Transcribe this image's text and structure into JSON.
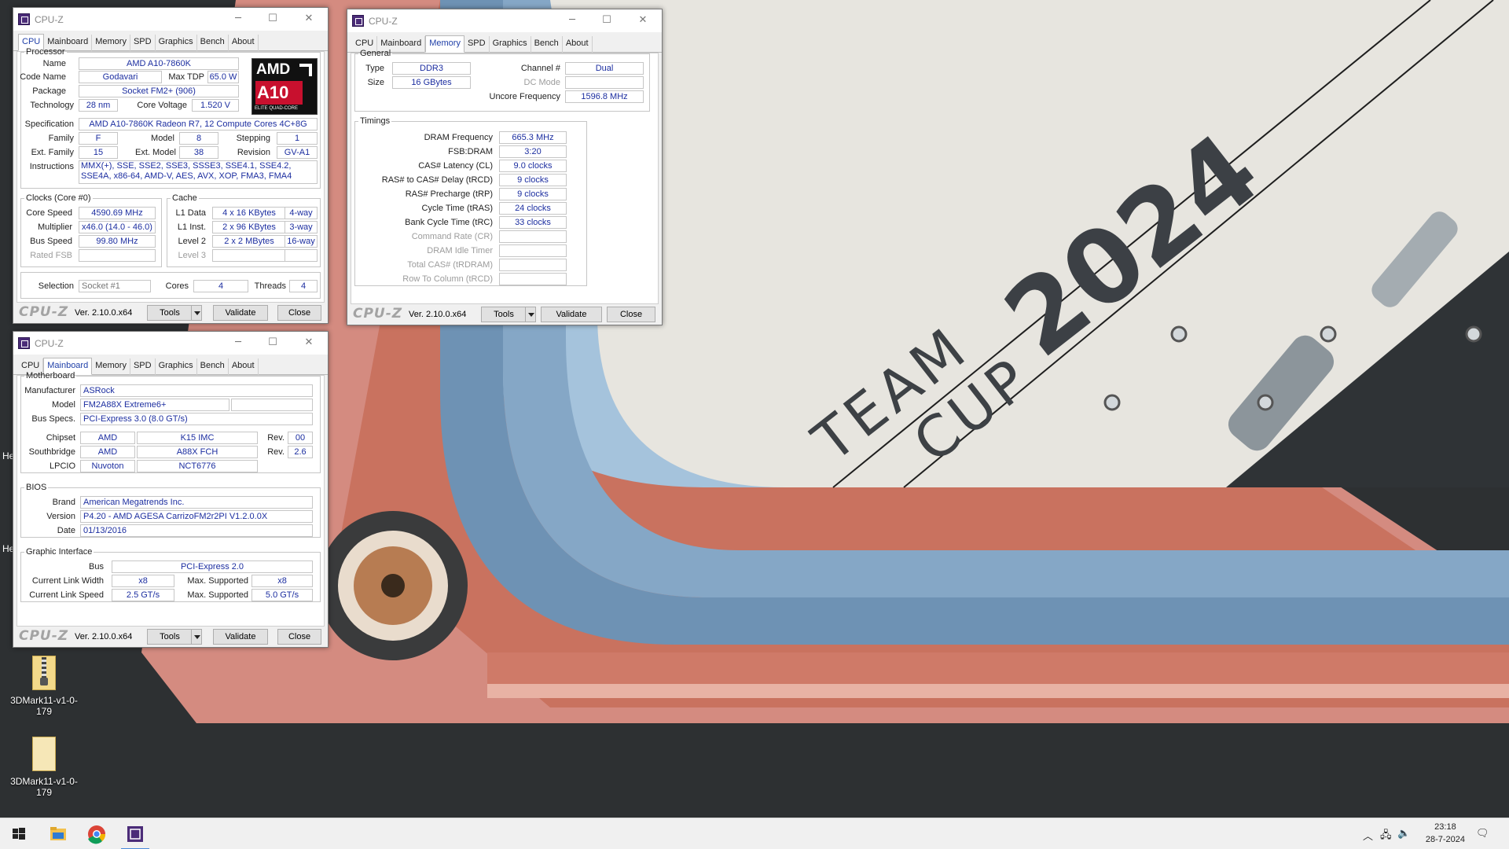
{
  "colors": {
    "accent_blue": "#1c2ea0",
    "tab_active": "#1f3fa8",
    "wallpaper_cream": "#e9e7e2",
    "wallpaper_blue": "#7396b8",
    "wallpaper_pink": "#d99084",
    "wallpaper_dark": "#2b2e2f"
  },
  "wallpaper": {
    "line1": "TEAM",
    "line2": "CUP",
    "year": "2024",
    "edge_text_1": "He",
    "edge_text_2": "He"
  },
  "desktop_icons": [
    {
      "label": "3DMark11-v1-0-179",
      "icon": "zip-folder-icon"
    },
    {
      "label": "3DMark11-v1-0-179",
      "icon": "folder-icon"
    }
  ],
  "common": {
    "title": "CPU-Z",
    "tabs": [
      "CPU",
      "Mainboard",
      "Memory",
      "SPD",
      "Graphics",
      "Bench",
      "About"
    ],
    "logo": "CPU-Z",
    "version": "Ver. 2.10.0.x64",
    "tools": "Tools",
    "validate": "Validate",
    "close": "Close"
  },
  "cpu": {
    "processor_legend": "Processor",
    "name_label": "Name",
    "name": "AMD A10-7860K",
    "codename_label": "Code Name",
    "codename": "Godavari",
    "maxtdp_label": "Max TDP",
    "maxtdp": "65.0 W",
    "package_label": "Package",
    "package": "Socket FM2+ (906)",
    "technology_label": "Technology",
    "technology": "28 nm",
    "corevoltage_label": "Core Voltage",
    "corevoltage": "1.520 V",
    "spec_label": "Specification",
    "spec": "AMD A10-7860K Radeon R7, 12 Compute Cores 4C+8G",
    "family_label": "Family",
    "family": "F",
    "model_label": "Model",
    "model": "8",
    "stepping_label": "Stepping",
    "stepping": "1",
    "extfamily_label": "Ext. Family",
    "extfamily": "15",
    "extmodel_label": "Ext. Model",
    "extmodel": "38",
    "revision_label": "Revision",
    "revision": "GV-A1",
    "instructions_label": "Instructions",
    "instructions": "MMX(+), SSE, SSE2, SSE3, SSSE3, SSE4.1, SSE4.2, SSE4A, x86-64, AMD-V, AES, AVX, XOP, FMA3, FMA4",
    "amd_logo": {
      "brand": "AMD",
      "model": "A10",
      "sub": "ELITE QUAD-CORE"
    },
    "clocks_legend": "Clocks (Core #0)",
    "corespeed_label": "Core Speed",
    "corespeed": "4590.69 MHz",
    "multiplier_label": "Multiplier",
    "multiplier": "x46.0 (14.0 - 46.0)",
    "busspeed_label": "Bus Speed",
    "busspeed": "99.80 MHz",
    "ratedfsb_label": "Rated FSB",
    "ratedfsb": "",
    "cache_legend": "Cache",
    "l1data_label": "L1 Data",
    "l1data": "4 x 16 KBytes",
    "l1data_way": "4-way",
    "l1inst_label": "L1 Inst.",
    "l1inst": "2 x 96 KBytes",
    "l1inst_way": "3-way",
    "l2_label": "Level 2",
    "l2": "2 x 2 MBytes",
    "l2_way": "16-way",
    "l3_label": "Level 3",
    "l3": "",
    "l3_way": "",
    "selection_label": "Selection",
    "selection": "Socket #1",
    "cores_label": "Cores",
    "cores": "4",
    "threads_label": "Threads",
    "threads": "4"
  },
  "memory": {
    "general_legend": "General",
    "type_label": "Type",
    "type": "DDR3",
    "size_label": "Size",
    "size": "16 GBytes",
    "channel_label": "Channel #",
    "channel": "Dual",
    "dcmode_label": "DC Mode",
    "dcmode": "",
    "uncore_label": "Uncore Frequency",
    "uncore": "1596.8 MHz",
    "timings_legend": "Timings",
    "timings": [
      {
        "label": "DRAM Frequency",
        "value": "665.3 MHz",
        "dim": false
      },
      {
        "label": "FSB:DRAM",
        "value": "3:20",
        "dim": false
      },
      {
        "label": "CAS# Latency (CL)",
        "value": "9.0 clocks",
        "dim": false
      },
      {
        "label": "RAS# to CAS# Delay (tRCD)",
        "value": "9 clocks",
        "dim": false
      },
      {
        "label": "RAS# Precharge (tRP)",
        "value": "9 clocks",
        "dim": false
      },
      {
        "label": "Cycle Time (tRAS)",
        "value": "24 clocks",
        "dim": false
      },
      {
        "label": "Bank Cycle Time (tRC)",
        "value": "33 clocks",
        "dim": false
      },
      {
        "label": "Command Rate (CR)",
        "value": "",
        "dim": true
      },
      {
        "label": "DRAM Idle Timer",
        "value": "",
        "dim": true
      },
      {
        "label": "Total CAS# (tRDRAM)",
        "value": "",
        "dim": true
      },
      {
        "label": "Row To Column (tRCD)",
        "value": "",
        "dim": true
      }
    ]
  },
  "mainboard": {
    "mb_legend": "Motherboard",
    "manufacturer_label": "Manufacturer",
    "manufacturer": "ASRock",
    "model_label": "Model",
    "model": "FM2A88X Extreme6+",
    "model_rev": "",
    "busspecs_label": "Bus Specs.",
    "busspecs": "PCI-Express 3.0 (8.0 GT/s)",
    "chipset_label": "Chipset",
    "chipset_vendor": "AMD",
    "chipset_name": "K15 IMC",
    "chipset_rev_label": "Rev.",
    "chipset_rev": "00",
    "southbridge_label": "Southbridge",
    "sb_vendor": "AMD",
    "sb_name": "A88X FCH",
    "sb_rev_label": "Rev.",
    "sb_rev": "2.6",
    "lpcio_label": "LPCIO",
    "lpcio_vendor": "Nuvoton",
    "lpcio_name": "NCT6776",
    "bios_legend": "BIOS",
    "brand_label": "Brand",
    "brand": "American Megatrends Inc.",
    "version_label": "Version",
    "version": "P4.20 - AMD AGESA CarrizoFM2r2PI  V1.2.0.0X",
    "date_label": "Date",
    "date": "01/13/2016",
    "gi_legend": "Graphic Interface",
    "bus_label": "Bus",
    "bus": "PCI-Express 2.0",
    "clw_label": "Current Link Width",
    "clw": "x8",
    "maxsup_label": "Max. Supported",
    "maxsup_w": "x8",
    "cls_label": "Current Link Speed",
    "cls": "2.5 GT/s",
    "maxsup_s": "5.0 GT/s"
  },
  "taskbar": {
    "apps": [
      "windows-start-icon",
      "file-explorer-icon",
      "chrome-icon",
      "cpuz-taskbar-icon"
    ],
    "time": "23:18",
    "date": "28-7-2024"
  }
}
